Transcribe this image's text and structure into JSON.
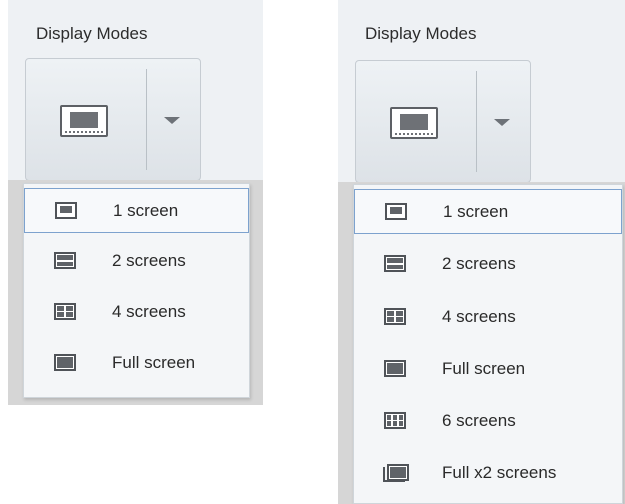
{
  "left_panel": {
    "title": "Display Modes",
    "button_icon": "single-screen-icon",
    "dropdown_icon": "chevron-down-icon",
    "items": [
      {
        "label": "1 screen",
        "icon": "one-screen-icon",
        "selected": true
      },
      {
        "label": "2 screens",
        "icon": "two-screens-icon",
        "selected": false
      },
      {
        "label": "4 screens",
        "icon": "four-screens-icon",
        "selected": false
      },
      {
        "label": "Full screen",
        "icon": "full-screen-icon",
        "selected": false
      }
    ]
  },
  "right_panel": {
    "title": "Display Modes",
    "button_icon": "single-screen-icon",
    "dropdown_icon": "chevron-down-icon",
    "items": [
      {
        "label": "1 screen",
        "icon": "one-screen-icon",
        "selected": true
      },
      {
        "label": "2 screens",
        "icon": "two-screens-icon",
        "selected": false
      },
      {
        "label": "4 screens",
        "icon": "four-screens-icon",
        "selected": false
      },
      {
        "label": "Full screen",
        "icon": "full-screen-icon",
        "selected": false
      },
      {
        "label": "6 screens",
        "icon": "six-screens-icon",
        "selected": false
      },
      {
        "label": "Full x2 screens",
        "icon": "full-x2-screens-icon",
        "selected": false
      }
    ]
  },
  "colors": {
    "header_bg": "#eef1f4",
    "menu_bg": "#f4f6f8",
    "selection_border": "#7da2ce",
    "icon_gray": "#5f6368"
  }
}
